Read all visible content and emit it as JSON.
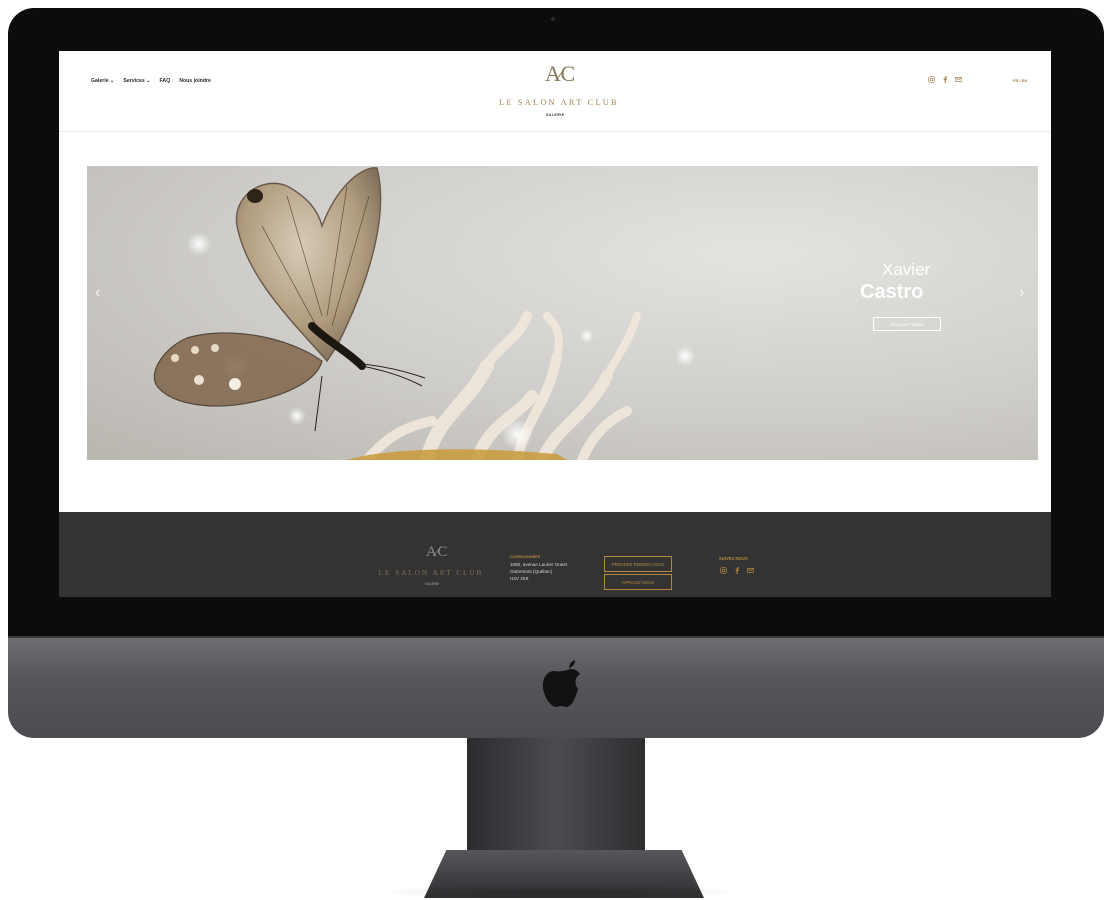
{
  "header": {
    "nav": [
      {
        "label": "Galerie ⌄"
      },
      {
        "label": "Services ⌄"
      },
      {
        "label": "FAQ"
      },
      {
        "label": "Nous joindre"
      }
    ],
    "logo_mark": "A⁄C",
    "logo_title": "LE SALON ART CLUB",
    "logo_subtitle": "GALERIE",
    "social_icons": [
      "instagram-icon",
      "facebook-icon",
      "mail-icon"
    ],
    "language": "FR / EN"
  },
  "hero": {
    "first_name": "Xavier",
    "last_name": "Castro",
    "button_label": "Découvrir l'artiste",
    "prev_arrow": "‹",
    "next_arrow": "›"
  },
  "footer": {
    "logo_mark": "A⁄C",
    "logo_title": "LE SALON ART CLUB",
    "logo_subtitle": "GALERIE",
    "coordinates_heading": "COORDONNÉES",
    "address_line1": "1060, avenue Laurier Ouest",
    "address_line2": "Outremont (Québec)",
    "address_line3": "H2V 2K8",
    "appointment_button": "PRENDRE RENDEZ-VOUS",
    "call_button": "APPELEZ-NOUS",
    "follow_heading": "SUIVEZ-NOUS",
    "social_icons": [
      "instagram-icon",
      "facebook-icon",
      "mail-icon"
    ]
  },
  "colors": {
    "accent_gold": "#b58a3e",
    "footer_bg": "#333334",
    "bezel": "#0c0c0d"
  }
}
